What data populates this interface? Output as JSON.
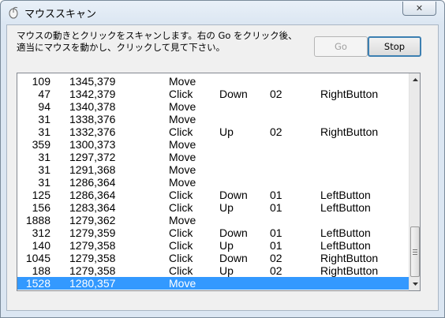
{
  "window": {
    "title": "マウススキャン",
    "close_glyph": "✕"
  },
  "instructions": {
    "line1": "マウスの動きとクリックをスキャンします。右の Go をクリック後、",
    "line2": "適当にマウスを動かし、クリックして見て下さい。"
  },
  "buttons": {
    "go_label": "Go",
    "stop_label": "Stop"
  },
  "log": {
    "selected_index": 16,
    "rows": [
      {
        "delay": "109",
        "coord": "1345,379",
        "type": "Move",
        "dir": "",
        "code": "",
        "button": ""
      },
      {
        "delay": "47",
        "coord": "1342,379",
        "type": "Click",
        "dir": "Down",
        "code": "02",
        "button": "RightButton"
      },
      {
        "delay": "94",
        "coord": "1340,378",
        "type": "Move",
        "dir": "",
        "code": "",
        "button": ""
      },
      {
        "delay": "31",
        "coord": "1338,376",
        "type": "Move",
        "dir": "",
        "code": "",
        "button": ""
      },
      {
        "delay": "31",
        "coord": "1332,376",
        "type": "Click",
        "dir": "Up",
        "code": "02",
        "button": "RightButton"
      },
      {
        "delay": "359",
        "coord": "1300,373",
        "type": "Move",
        "dir": "",
        "code": "",
        "button": ""
      },
      {
        "delay": "31",
        "coord": "1297,372",
        "type": "Move",
        "dir": "",
        "code": "",
        "button": ""
      },
      {
        "delay": "31",
        "coord": "1291,368",
        "type": "Move",
        "dir": "",
        "code": "",
        "button": ""
      },
      {
        "delay": "31",
        "coord": "1286,364",
        "type": "Move",
        "dir": "",
        "code": "",
        "button": ""
      },
      {
        "delay": "125",
        "coord": "1286,364",
        "type": "Click",
        "dir": "Down",
        "code": "01",
        "button": "LeftButton"
      },
      {
        "delay": "156",
        "coord": "1283,364",
        "type": "Click",
        "dir": "Up",
        "code": "01",
        "button": "LeftButton"
      },
      {
        "delay": "1888",
        "coord": "1279,362",
        "type": "Move",
        "dir": "",
        "code": "",
        "button": ""
      },
      {
        "delay": "312",
        "coord": "1279,359",
        "type": "Click",
        "dir": "Down",
        "code": "01",
        "button": "LeftButton"
      },
      {
        "delay": "140",
        "coord": "1279,358",
        "type": "Click",
        "dir": "Up",
        "code": "01",
        "button": "LeftButton"
      },
      {
        "delay": "1045",
        "coord": "1279,358",
        "type": "Click",
        "dir": "Down",
        "code": "02",
        "button": "RightButton"
      },
      {
        "delay": "188",
        "coord": "1279,358",
        "type": "Click",
        "dir": "Up",
        "code": "02",
        "button": "RightButton"
      },
      {
        "delay": "1528",
        "coord": "1280,357",
        "type": "Move",
        "dir": "",
        "code": "",
        "button": ""
      }
    ]
  },
  "scrollbar": {
    "up_icon": "scroll-up-arrow",
    "down_icon": "scroll-down-arrow",
    "position_fraction": 1.0
  },
  "colors": {
    "selection": "#3399ff",
    "stop_border": "#3c7fb1"
  }
}
